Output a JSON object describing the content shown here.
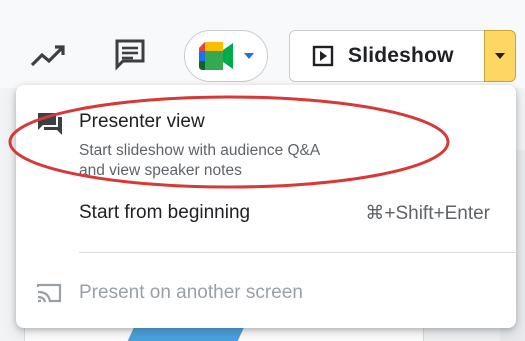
{
  "toolbar": {
    "icons": [
      "trending-up-icon",
      "comment-icon",
      "google-meet-icon",
      "chevron-down-icon"
    ],
    "slideshow_label": "Slideshow",
    "accent_color": "#fdd663"
  },
  "menu": {
    "items": [
      {
        "label": "Presenter view",
        "sublabel_line1": "Start slideshow with audience Q&A",
        "sublabel_line2": "and view speaker notes",
        "icon": "presenter-view-icon",
        "enabled": true
      },
      {
        "label": "Start from beginning",
        "shortcut": "⌘+Shift+Enter",
        "enabled": true
      },
      {
        "label": "Present on another screen",
        "icon": "cast-icon",
        "enabled": false
      }
    ]
  },
  "annotation": {
    "shape": "ellipse",
    "color": "#d93838"
  }
}
